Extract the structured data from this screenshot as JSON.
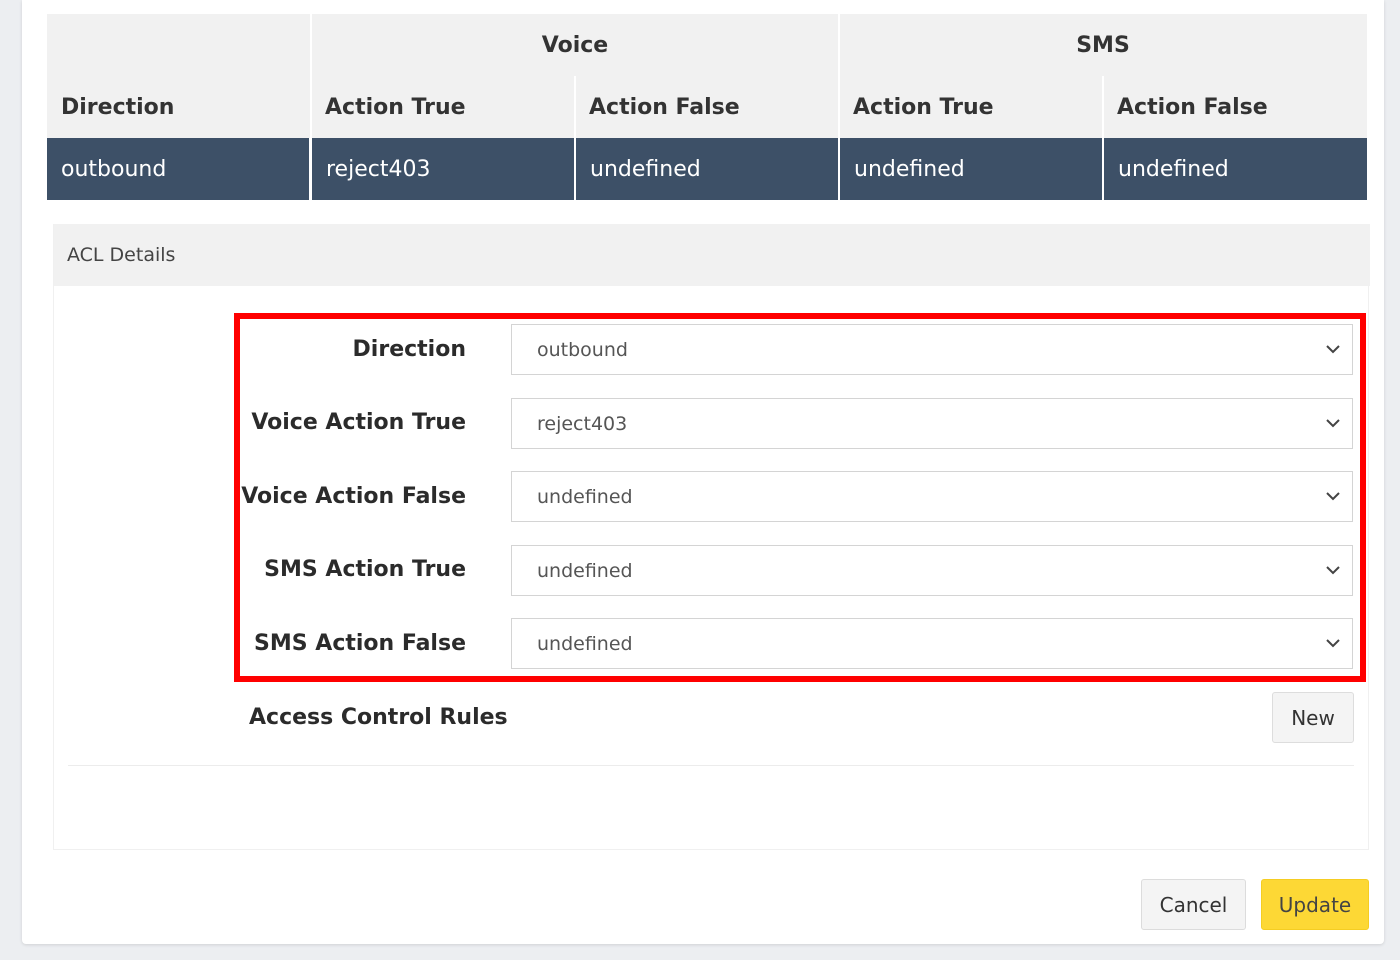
{
  "table": {
    "group_headers": [
      "Voice",
      "SMS"
    ],
    "columns": [
      "Direction",
      "Action True",
      "Action False",
      "Action True",
      "Action False"
    ],
    "rows": [
      [
        "outbound",
        "reject403",
        "undefined",
        "undefined",
        "undefined"
      ]
    ]
  },
  "acl": {
    "title": "ACL Details",
    "fields": [
      {
        "label": "Direction",
        "value": "outbound"
      },
      {
        "label": "Voice Action True",
        "value": "reject403"
      },
      {
        "label": "Voice Action False",
        "value": "undefined"
      },
      {
        "label": "SMS Action True",
        "value": "undefined"
      },
      {
        "label": "SMS Action False",
        "value": "undefined"
      }
    ],
    "rules_title": "Access Control Rules",
    "new_label": "New"
  },
  "footer": {
    "cancel_label": "Cancel",
    "update_label": "Update"
  },
  "colors": {
    "row_bg": "#3d5067",
    "highlight": "#ff0000",
    "update_bg": "#fdd835"
  },
  "icons": {
    "select": "chevron-down-icon"
  }
}
